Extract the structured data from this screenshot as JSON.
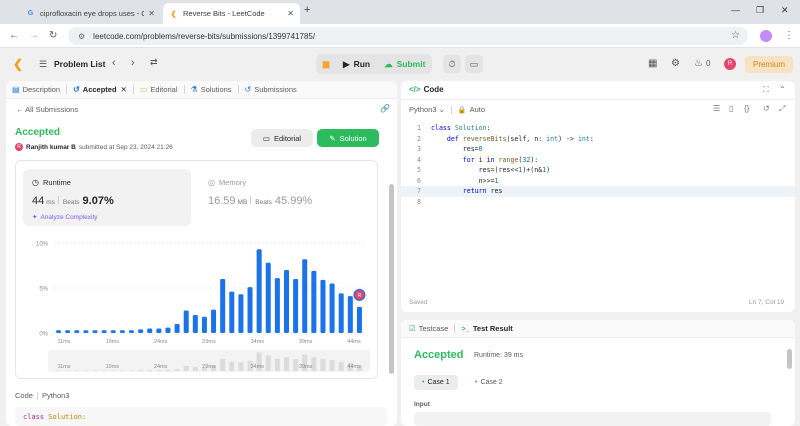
{
  "browser": {
    "tabs": [
      {
        "title": "ciprofloxacin eye drops uses - G",
        "favicon": "google-icon"
      },
      {
        "title": "Reverse Bits - LeetCode",
        "favicon": "leetcode-icon"
      }
    ],
    "url": "leetcode.com/problems/reverse-bits/submissions/1399741785/"
  },
  "header": {
    "problem_list": "Problem List",
    "run": "Run",
    "submit": "Submit",
    "streak": "0",
    "avatar_initial": "R",
    "premium": "Premium"
  },
  "left_panel": {
    "tabs": [
      {
        "label": "Description",
        "icon": "description-icon"
      },
      {
        "label": "Accepted",
        "icon": "history-icon"
      },
      {
        "label": "Editorial",
        "icon": "book-icon"
      },
      {
        "label": "Solutions",
        "icon": "flask-icon"
      },
      {
        "label": "Submissions",
        "icon": "clock-icon"
      }
    ],
    "all_submissions": "All Submissions",
    "status": "Accepted",
    "author": "Ranjith kumar B",
    "author_initial": "R",
    "submitted_at": "submitted at Sep 23, 2024 21:26",
    "editorial_btn": "Editorial",
    "solution_btn": "Solution",
    "runtime": {
      "label": "Runtime",
      "value": "44",
      "unit": "ms",
      "beats_label": "Beats",
      "beats": "9.07%",
      "analyze": "Analyze Complexity"
    },
    "memory": {
      "label": "Memory",
      "value": "16.59",
      "unit": "MB",
      "beats_label": "Beats",
      "beats": "45.99%"
    },
    "code_label": "Code",
    "code_lang": "Python3",
    "code_preview": {
      "kw": "class",
      "name": "Solution:"
    }
  },
  "chart_data": {
    "type": "bar",
    "title": "",
    "xlabel": "",
    "ylabel": "",
    "ylim": [
      0,
      10
    ],
    "y_ticks": [
      "0%",
      "5%",
      "10%"
    ],
    "x_ticks": [
      "11ms",
      "19ms",
      "24ms",
      "29ms",
      "34ms",
      "39ms",
      "44ms"
    ],
    "values": [
      0.3,
      0.3,
      0.3,
      0.3,
      0.3,
      0.3,
      0.3,
      0.3,
      0.3,
      0.4,
      0.5,
      0.5,
      0.6,
      1.0,
      2.5,
      2.0,
      1.8,
      2.6,
      6.0,
      4.6,
      4.3,
      5.1,
      9.3,
      7.8,
      6.1,
      7.0,
      6.0,
      8.2,
      6.9,
      5.9,
      5.5,
      4.4,
      4.1,
      2.9
    ],
    "highlight_index": 33,
    "highlight_label": "R",
    "bar_color": "#1a73e8",
    "grid": true
  },
  "editor": {
    "tab": "Code",
    "language": "Python3",
    "mode": "Auto",
    "lines": [
      [
        {
          "t": "class ",
          "c": "kw"
        },
        {
          "t": "Solution",
          "c": "bi"
        },
        {
          "t": ":",
          "c": "tx"
        }
      ],
      [
        {
          "t": "    ",
          "c": "tx"
        },
        {
          "t": "def ",
          "c": "kw"
        },
        {
          "t": "reverseBits",
          "c": "fn"
        },
        {
          "t": "(self, n: ",
          "c": "tx"
        },
        {
          "t": "int",
          "c": "bi"
        },
        {
          "t": ") -> ",
          "c": "tx"
        },
        {
          "t": "int",
          "c": "bi"
        },
        {
          "t": ":",
          "c": "tx"
        }
      ],
      [
        {
          "t": "        res=",
          "c": "tx"
        },
        {
          "t": "0",
          "c": "nm"
        }
      ],
      [
        {
          "t": "        ",
          "c": "tx"
        },
        {
          "t": "for ",
          "c": "kw"
        },
        {
          "t": "i ",
          "c": "tx"
        },
        {
          "t": "in ",
          "c": "kw"
        },
        {
          "t": "range",
          "c": "fn"
        },
        {
          "t": "(",
          "c": "tx"
        },
        {
          "t": "32",
          "c": "nm"
        },
        {
          "t": "):",
          "c": "tx"
        }
      ],
      [
        {
          "t": "            res=(res<<",
          "c": "tx"
        },
        {
          "t": "1",
          "c": "nm"
        },
        {
          "t": ")+(n&",
          "c": "tx"
        },
        {
          "t": "1",
          "c": "nm"
        },
        {
          "t": ")",
          "c": "tx"
        }
      ],
      [
        {
          "t": "            n>>=",
          "c": "tx"
        },
        {
          "t": "1",
          "c": "nm"
        }
      ],
      [
        {
          "t": "        ",
          "c": "tx"
        },
        {
          "t": "return ",
          "c": "kw"
        },
        {
          "t": "res",
          "c": "tx"
        }
      ],
      []
    ],
    "current_line": 7,
    "saved": "Saved",
    "cursor": "Ln 7, Col 19"
  },
  "result": {
    "tabs": [
      {
        "label": "Testcase",
        "icon": "check-box-icon"
      },
      {
        "label": "Test Result",
        "icon": "terminal-icon"
      }
    ],
    "status": "Accepted",
    "runtime": "Runtime: 39 ms",
    "cases": [
      "Case 1",
      "Case 2"
    ],
    "input_label": "Input"
  },
  "colors": {
    "accent_green": "#2cbb5d",
    "brand_orange": "#f89f1b",
    "chart_blue": "#1a73e8",
    "highlight_pink": "#e8446b"
  }
}
